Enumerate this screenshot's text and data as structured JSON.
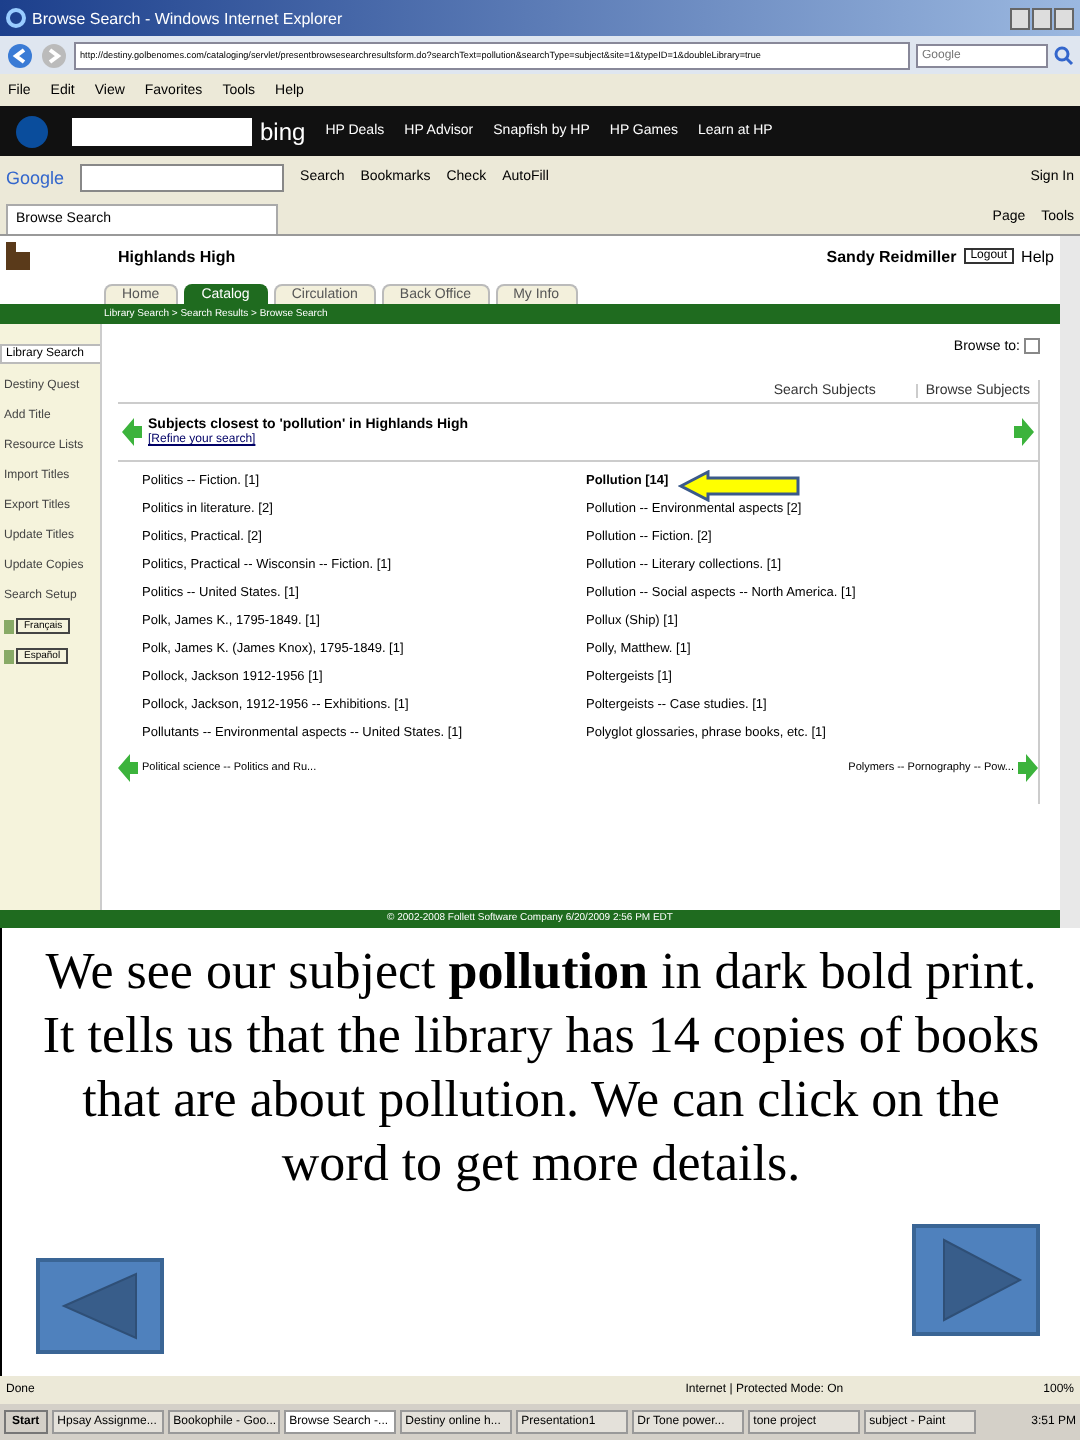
{
  "window": {
    "title": "Browse Search - Windows Internet Explorer"
  },
  "address_bar": {
    "url": "http://destiny.golbenomes.com/cataloging/servlet/presentbrowsesearchresultsform.do?searchText=pollution&searchType=subject&site=1&typeID=1&doubleLibrary=true"
  },
  "search_box": {
    "placeholder": "Google"
  },
  "menu": [
    "File",
    "Edit",
    "View",
    "Favorites",
    "Tools",
    "Help"
  ],
  "hp_toolbar": {
    "search_brand": "bing",
    "items": [
      "HP Deals",
      "HP Advisor",
      "Snapfish by HP",
      "HP Games",
      "Learn at HP"
    ]
  },
  "google_toolbar": {
    "brand": "Google",
    "items": [
      "Search",
      "Bookmarks",
      "Check",
      "AutoFill"
    ],
    "sign_in": "Sign In"
  },
  "browser_tab": {
    "title": "Browse Search"
  },
  "command_bar": [
    "Page",
    "Tools"
  ],
  "header": {
    "site": "Highlands High",
    "user": "Sandy Reidmiller",
    "logout": "Logout",
    "help": "Help"
  },
  "nav_tabs": [
    {
      "label": "Home",
      "selected": false
    },
    {
      "label": "Catalog",
      "selected": true
    },
    {
      "label": "Circulation",
      "selected": false
    },
    {
      "label": "Back Office",
      "selected": false
    },
    {
      "label": "My Info",
      "selected": false
    }
  ],
  "breadcrumb": "Library Search > Search Results > Browse Search",
  "sidebar": {
    "items": [
      {
        "label": "Library Search",
        "selected": true
      },
      {
        "label": "Destiny Quest",
        "selected": false
      },
      {
        "label": "Add Title",
        "selected": false
      },
      {
        "label": "Resource Lists",
        "selected": false
      },
      {
        "label": "Import Titles",
        "selected": false
      },
      {
        "label": "Export Titles",
        "selected": false
      },
      {
        "label": "Update Titles",
        "selected": false
      },
      {
        "label": "Update Copies",
        "selected": false
      },
      {
        "label": "Search Setup",
        "selected": false
      }
    ],
    "languages": [
      "Français",
      "Español"
    ]
  },
  "browse_to": "Browse to:",
  "subject_tabs": [
    {
      "label": "Search Subjects",
      "selected": false
    },
    {
      "label": "Browse Subjects",
      "selected": true
    }
  ],
  "results": {
    "heading": "Subjects closest to 'pollution' in Highlands High",
    "refine": "[Refine your search]",
    "left": [
      {
        "text": "Politics -- Fiction. [1]",
        "match": false
      },
      {
        "text": "Politics in literature. [2]",
        "match": false
      },
      {
        "text": "Politics, Practical. [2]",
        "match": false
      },
      {
        "text": "Politics, Practical -- Wisconsin -- Fiction. [1]",
        "match": false
      },
      {
        "text": "Politics -- United States. [1]",
        "match": false
      },
      {
        "text": "Polk, James K., 1795-1849. [1]",
        "match": false
      },
      {
        "text": "Polk, James K. (James Knox), 1795-1849. [1]",
        "match": false
      },
      {
        "text": "Pollock, Jackson 1912-1956 [1]",
        "match": false
      },
      {
        "text": "Pollock, Jackson, 1912-1956 -- Exhibitions. [1]",
        "match": false
      },
      {
        "text": "Pollutants -- Environmental aspects -- United States. [1]",
        "match": false
      }
    ],
    "right": [
      {
        "text": "Pollution [14]",
        "match": true
      },
      {
        "text": "Pollution -- Environmental aspects [2]",
        "match": false
      },
      {
        "text": "Pollution -- Fiction. [2]",
        "match": false
      },
      {
        "text": "Pollution -- Literary collections. [1]",
        "match": false
      },
      {
        "text": "Pollution -- Social aspects -- North America. [1]",
        "match": false
      },
      {
        "text": "Pollux (Ship) [1]",
        "match": false
      },
      {
        "text": "Polly, Matthew. [1]",
        "match": false
      },
      {
        "text": "Poltergeists [1]",
        "match": false
      },
      {
        "text": "Poltergeists -- Case studies. [1]",
        "match": false
      },
      {
        "text": "Polyglot glossaries, phrase books, etc. [1]",
        "match": false
      }
    ],
    "previous": "Political science -- Politics and Ru...",
    "next": "Polymers -- Pornography -- Pow..."
  },
  "footer": "© 2002-2008 Follett Software Company   6/20/2009 2:56 PM EDT",
  "caption": "We see our subject **pollution** in dark bold print.  It tells us that the library has 14 copies of books that are about pollution.  We can click on the word to get more details.",
  "status_bar": {
    "text": "Done",
    "zone": "Internet | Protected Mode: On",
    "zoom": "100%"
  },
  "taskbar": {
    "start": "Start",
    "items": [
      {
        "label": "Hpsay Assignme...",
        "selected": false
      },
      {
        "label": "Bookophile - Goo...",
        "selected": false
      },
      {
        "label": "Browse Search -...",
        "selected": true
      },
      {
        "label": "Destiny online h...",
        "selected": false
      },
      {
        "label": "Presentation1",
        "selected": false
      },
      {
        "label": "Dr Tone power...",
        "selected": false
      },
      {
        "label": "tone project",
        "selected": false
      },
      {
        "label": "subject - Paint",
        "selected": false
      }
    ],
    "clock": "3:51 PM"
  }
}
